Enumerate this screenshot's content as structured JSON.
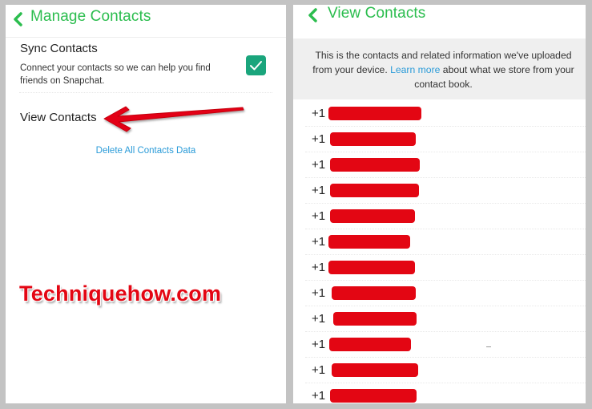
{
  "left": {
    "nav_title": "Manage Contacts",
    "back_icon": "chevron-left-icon",
    "sync": {
      "title": "Sync Contacts",
      "description": "Connect your contacts so we can help you find friends on Snapchat.",
      "checked": true,
      "checkbox_icon": "checkmark-icon"
    },
    "view_contacts_label": "View Contacts",
    "delete_label": "Delete All Contacts Data",
    "annotation_icon": "red-arrow-icon",
    "watermark": "Techniquehow.com"
  },
  "right": {
    "nav_title": "View Contacts",
    "back_icon": "chevron-left-icon",
    "info": {
      "text_before": "This is the contacts and related information we've uploaded from your device. ",
      "link": "Learn more",
      "text_after": " about what we store from your contact book."
    },
    "contacts": [
      {
        "prefix": "+1",
        "redacted": true
      },
      {
        "prefix": "+1",
        "redacted": true
      },
      {
        "prefix": "+1",
        "redacted": true
      },
      {
        "prefix": "+1",
        "redacted": true
      },
      {
        "prefix": "+1",
        "redacted": true
      },
      {
        "prefix": "+1",
        "redacted": true
      },
      {
        "prefix": "+1",
        "redacted": true
      },
      {
        "prefix": "+1",
        "redacted": true
      },
      {
        "prefix": "+1",
        "redacted": true
      },
      {
        "prefix": "+1",
        "redacted": true
      },
      {
        "prefix": "+1",
        "redacted": true
      },
      {
        "prefix": "+1",
        "redacted": true
      }
    ]
  },
  "colors": {
    "accent_green": "#2bbd4e",
    "checkbox_teal": "#1aa57c",
    "link_blue": "#2a9bd8",
    "redaction_red": "#e30613"
  }
}
